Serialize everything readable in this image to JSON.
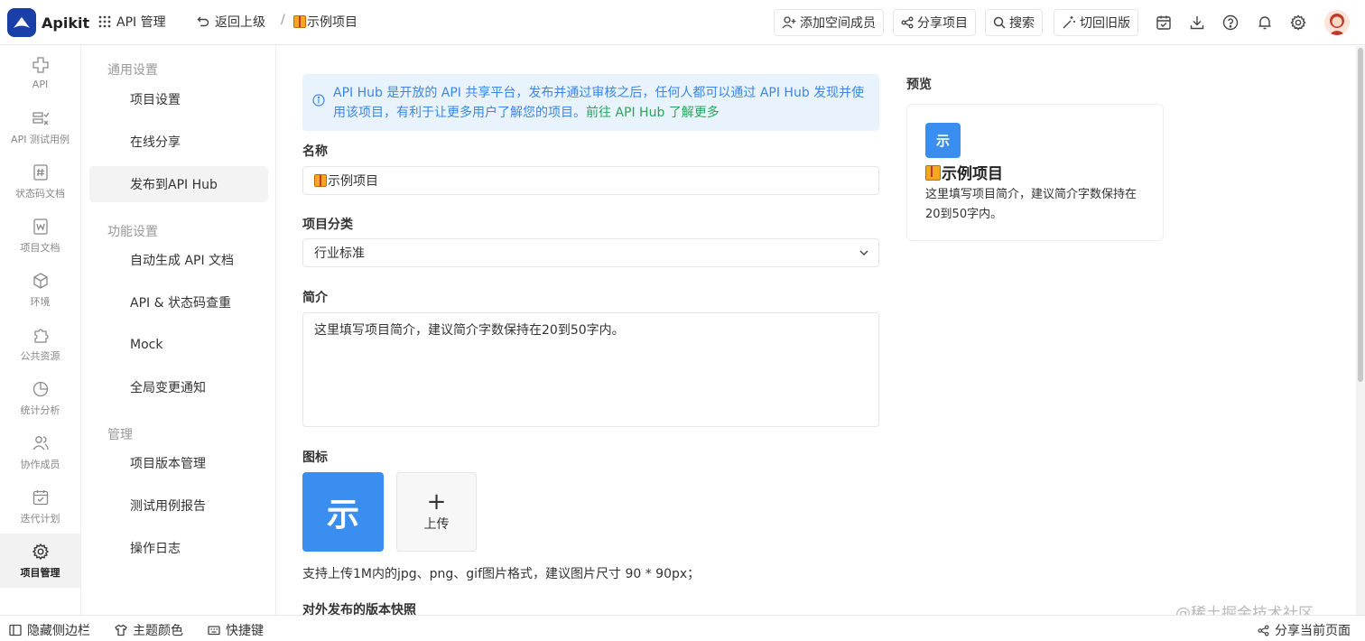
{
  "topbar": {
    "app_name": "Apikit",
    "module": "API 管理",
    "back": "返回上级",
    "separator": "/",
    "project": "示例项目",
    "buttons": {
      "add_member": "添加空间成员",
      "share": "分享项目",
      "search": "搜索",
      "old_version": "切回旧版"
    }
  },
  "leftnav": {
    "items": [
      {
        "label": "API",
        "icon": "api-icon"
      },
      {
        "label": "API 测试用例",
        "icon": "test-case-icon"
      },
      {
        "label": "状态码文档",
        "icon": "status-code-icon"
      },
      {
        "label": "项目文档",
        "icon": "doc-icon"
      },
      {
        "label": "环境",
        "icon": "environment-icon"
      },
      {
        "label": "公共资源",
        "icon": "puzzle-icon"
      },
      {
        "label": "统计分析",
        "icon": "pie-chart-icon"
      },
      {
        "label": "协作成员",
        "icon": "users-icon"
      },
      {
        "label": "迭代计划",
        "icon": "calendar-icon"
      },
      {
        "label": "项目管理",
        "icon": "gear-icon"
      }
    ],
    "active": "项目管理"
  },
  "subnav": {
    "groups": {
      "general": "通用设置",
      "features": "功能设置",
      "manage": "管理"
    },
    "items": {
      "project_settings": "项目设置",
      "online_share": "在线分享",
      "publish_hub": "发布到API Hub",
      "auto_doc": "自动生成 API 文档",
      "dup_check": "API & 状态码查重",
      "mock": "Mock",
      "change_notice": "全局变更通知",
      "version_mgmt": "项目版本管理",
      "test_report": "测试用例报告",
      "op_log": "操作日志"
    }
  },
  "form": {
    "info_text": "API Hub 是开放的 API 共享平台，发布并通过审核之后，任何人都可以通过 API Hub 发现并使用该项目，有利于让更多用户了解您的项目。",
    "info_link": "前往 API Hub 了解更多",
    "name_label": "名称",
    "name_value": "示例项目",
    "category_label": "项目分类",
    "category_value": "行业标准",
    "intro_label": "简介",
    "intro_value": "这里填写项目简介，建议简介字数保持在20到50字内。",
    "icon_label": "图标",
    "icon_char": "示",
    "upload_label": "上传",
    "upload_plus": "+",
    "upload_hint": "支持上传1M内的jpg、png、gif图片格式，建议图片尺寸 90 * 90px；",
    "snapshot_label": "对外发布的版本快照"
  },
  "preview": {
    "title": "预览",
    "icon_char": "示",
    "name": "示例项目",
    "desc": "这里填写项目简介，建议简介字数保持在20到50字内。"
  },
  "bottombar": {
    "hide_sidebar": "隐藏侧边栏",
    "theme": "主题颜色",
    "shortcuts": "快捷键",
    "share_page": "分享当前页面"
  },
  "watermark": "@稀土掘金技术社区",
  "colors": {
    "brand": "#1a3fa6",
    "accent": "#3a8ef0",
    "info_bg": "#e8f3fd",
    "link_green": "#27a65a"
  }
}
